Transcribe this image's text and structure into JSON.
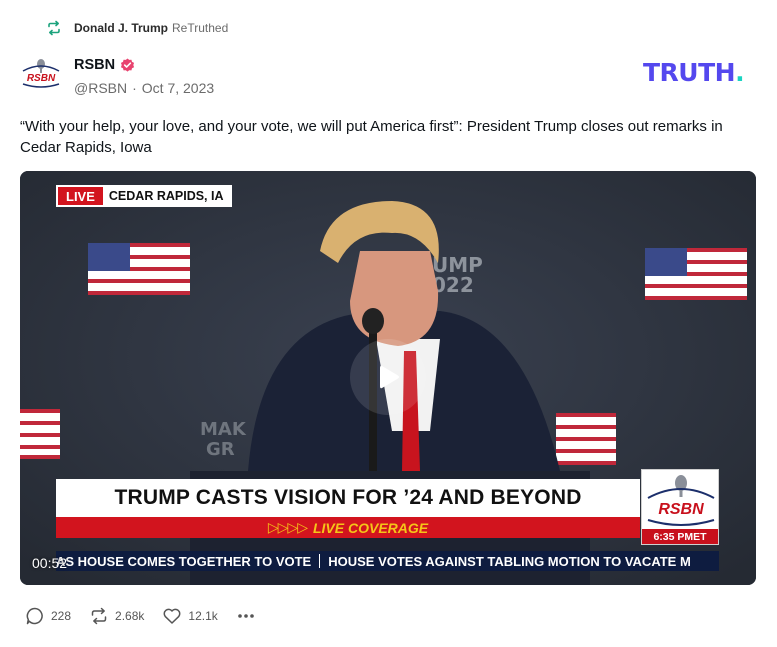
{
  "retruth": {
    "icon": "retruth-icon",
    "user": "Donald J. Trump",
    "label": "ReTruthed"
  },
  "author": {
    "name": "RSBN",
    "verified_icon": "verified-badge-icon",
    "handle": "@RSBN",
    "separator": "·",
    "date": "Oct 7, 2023",
    "avatar_text": "RSBN"
  },
  "brand": {
    "logo_text": "TRUTH",
    "logo_dot": ".",
    "colors": {
      "primary": "#5448ee",
      "accent": "#19d4c2"
    }
  },
  "post": {
    "text": "“With your help, your love, and your vote, we will put America first”: President Trump closes out remarks in Cedar Rapids, Iowa"
  },
  "video": {
    "live_badge": "LIVE",
    "location": "CEDAR RAPIDS, IA",
    "headline": "TRUMP CASTS VISION FOR ’24 AND BEYOND",
    "live_coverage_arrows": "▷▷▷▷",
    "live_coverage": "LIVE COVERAGE",
    "network_logo": "RSBN",
    "broadcast_time": "6:35 PMET",
    "ticker": [
      "AS HOUSE COMES TOGETHER TO VOTE",
      "HOUSE VOTES AGAINST TABLING MOTION TO VACATE M"
    ],
    "backdrop_text_1": "UMP",
    "backdrop_text_2": "022",
    "backdrop_text_3": "MAK",
    "backdrop_text_4": "GR",
    "timestamp": "00:52",
    "play_icon": "play-icon"
  },
  "actions": {
    "reply_count": "228",
    "retruth_count": "2.68k",
    "like_count": "12.1k",
    "more_icon": "more-icon"
  }
}
